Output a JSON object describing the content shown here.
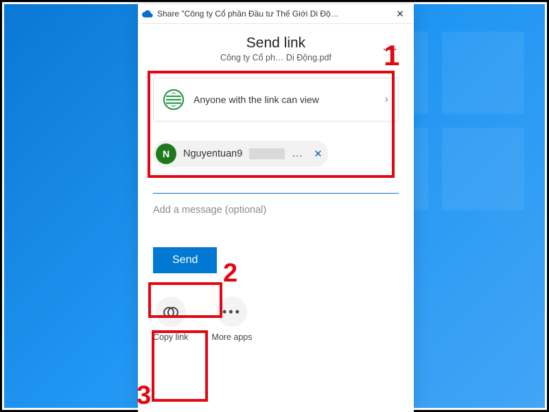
{
  "titlebar": {
    "text": "Share \"Công ty Cổ phần Đầu tư Thế Giới Di Độ…",
    "close": "✕"
  },
  "header": {
    "title": "Send link",
    "filename": "Công ty Cổ ph… Di Động.pdf",
    "more": "···"
  },
  "permission": {
    "text": "Anyone with the link can view",
    "chevron": "›"
  },
  "recipient": {
    "initial": "N",
    "name": "Nguyentuan9",
    "ellipsis": "…",
    "remove": "✕"
  },
  "message_placeholder": "Add a message (optional)",
  "buttons": {
    "send": "Send"
  },
  "actions": {
    "copy_link": "Copy link",
    "more_apps": "More apps"
  },
  "annotations": {
    "n1": "1",
    "n2": "2",
    "n3": "3"
  }
}
